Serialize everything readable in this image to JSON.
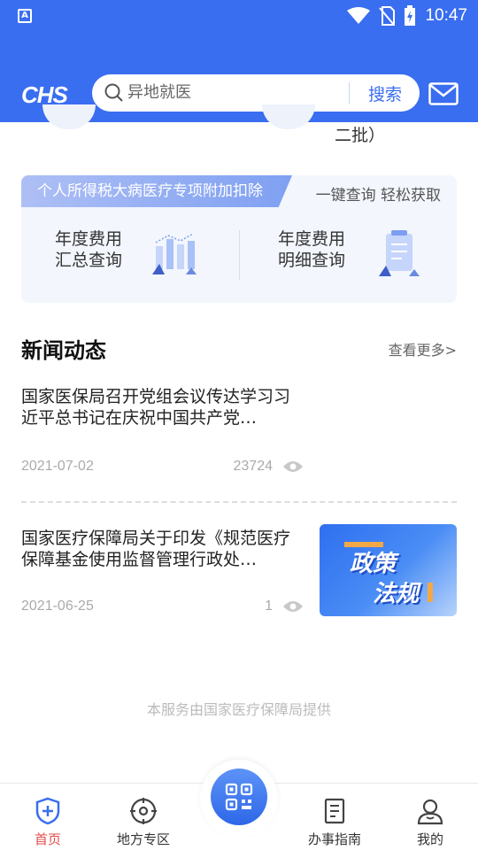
{
  "status_bar": {
    "time": "10:47",
    "left_icon": "a-icon",
    "icons": [
      "wifi-icon",
      "no-sim-icon",
      "battery-charging-icon"
    ]
  },
  "header": {
    "logo_text": "CHS",
    "search": {
      "value": "异地就医",
      "button_label": "搜索"
    },
    "mail_icon": "mail-icon"
  },
  "peek": {
    "text": "二批）"
  },
  "tax_card": {
    "tag": "个人所得税大病医疗专项附加扣除",
    "slogan": "一键查询 轻松获取",
    "items": [
      {
        "label": "年度费用汇总查询",
        "icon": "bar-chart-icon"
      },
      {
        "label": "年度费用明细查询",
        "icon": "document-list-icon"
      }
    ]
  },
  "news": {
    "title": "新闻动态",
    "more": "查看更多>",
    "items": [
      {
        "headline": "国家医保局召开党组会议传达学习习近平总书记在庆祝中国共产党…",
        "date": "2021-07-02",
        "views": "23724"
      },
      {
        "headline": "国家医疗保障局关于印发《规范医疗保障基金使用监督管理行政处…",
        "date": "2021-06-25",
        "views": "1",
        "thumb_text_1": "政策",
        "thumb_text_2": "法规"
      }
    ]
  },
  "footer_note": "本服务由国家医疗保障局提供",
  "bottom_nav": {
    "items": [
      {
        "label": "首页",
        "icon": "shield-plus-icon",
        "active": true
      },
      {
        "label": "地方专区",
        "icon": "location-target-icon",
        "active": false
      },
      {
        "label": "办事指南",
        "icon": "guide-document-icon",
        "active": false
      },
      {
        "label": "我的",
        "icon": "user-icon",
        "active": false
      }
    ],
    "center_icon": "qr-scan-icon"
  },
  "colors": {
    "primary": "#3a6ef0",
    "active_nav": "#e34b4b",
    "muted": "#aaaaaa"
  }
}
